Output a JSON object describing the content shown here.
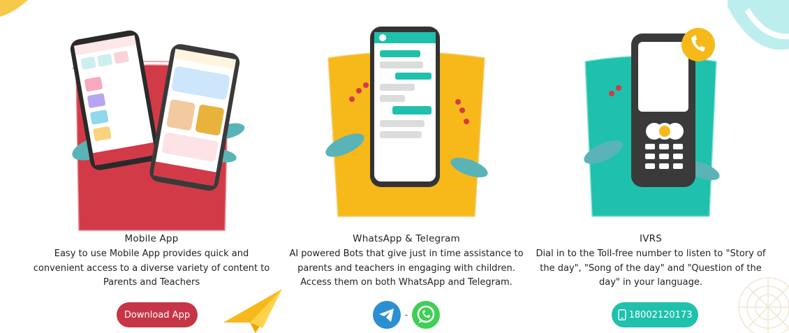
{
  "colors": {
    "red": "#c63546",
    "yellow": "#f7b81a",
    "teal": "#1fc1ac",
    "telegram": "#2a8fd3",
    "whatsapp": "#3fcf55"
  },
  "features": [
    {
      "title": "Mobile App",
      "description": "Easy to use Mobile App provides quick and convenient access to a diverse variety of content to Parents and Teachers",
      "button_label": "Download App",
      "icon": "mobile-phones-illustration"
    },
    {
      "title": "WhatsApp & Telegram",
      "description": "AI powered Bots that give just in time assistance to parents and teachers in engaging with children. Access them on both WhatsApp and Telegram.",
      "separator": "-",
      "icon": "chat-phone-illustration",
      "links": [
        "telegram-icon",
        "whatsapp-icon"
      ]
    },
    {
      "title": "IVRS",
      "description": "Dial in to the Toll-free number to listen to \"Story of the day\", \"Song of the day\" and \"Question of the day\" in your language.",
      "phone_number": "18002120173",
      "icon": "feature-phone-illustration"
    }
  ]
}
